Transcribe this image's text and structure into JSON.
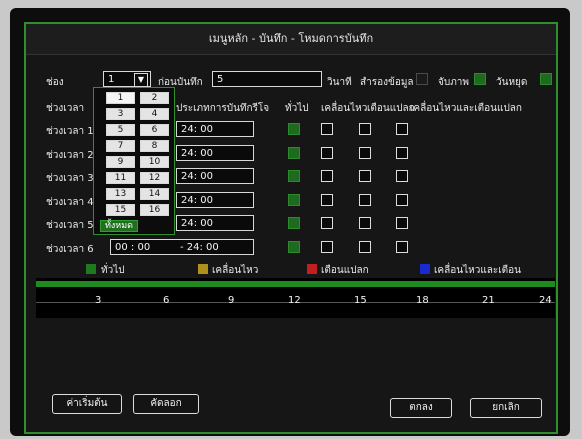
{
  "window": {
    "title": "เมนูหลัก - บันทึก - โหมดการบันทึก"
  },
  "channel": {
    "label": "ช่อง",
    "value": "1"
  },
  "prerecord": {
    "label": "ก่อนบันทึก",
    "value": "5",
    "unit": "วินาที"
  },
  "options": {
    "redundancy": "สำรองข้อมูล",
    "snapshot": "จับภาพ",
    "holiday": "วันหยุด"
  },
  "schedule": {
    "period_header": "ช่วงเวลา",
    "type_header": "ประเภทการบันทึกรีโจ",
    "col_general": "ทั่วไป",
    "col_motion": "เคลื่อนไหว",
    "col_alarm": "เตือนแปลก",
    "col_motion_alarm": "เคลื่อนไหวและเตือนแปลก",
    "rows": [
      {
        "label": "ช่วงเวลา 1",
        "start": "",
        "end": "24: 00"
      },
      {
        "label": "ช่วงเวลา 2",
        "start": "",
        "end": "24: 00"
      },
      {
        "label": "ช่วงเวลา 3",
        "start": "",
        "end": "24: 00"
      },
      {
        "label": "ช่วงเวลา 4",
        "start": "",
        "end": "24: 00"
      },
      {
        "label": "ช่วงเวลา 5",
        "start": "",
        "end": "24: 00"
      },
      {
        "label": "ช่วงเวลา 6",
        "start": "00 : 00",
        "end": "- 24: 00"
      }
    ]
  },
  "dropdown": {
    "options": [
      "1",
      "2",
      "3",
      "4",
      "5",
      "6",
      "7",
      "8",
      "9",
      "10",
      "11",
      "12",
      "13",
      "14",
      "15",
      "16"
    ],
    "all": "ทั้งหมด"
  },
  "legend": {
    "general": "ทั่วไป",
    "motion": "เคลื่อนไหว",
    "alarm": "เตือนแปลก",
    "motion_alarm": "เคลื่อนไหวและเตือน"
  },
  "timeline": {
    "ticks": [
      "3",
      "6",
      "9",
      "12",
      "15",
      "18",
      "21",
      "24"
    ]
  },
  "buttons": {
    "default": "ค่าเริ่มต้น",
    "copy": "คัดลอก",
    "ok": "ตกลง",
    "cancel": "ยกเลิก"
  },
  "colors": {
    "general": "#1e7a1e",
    "motion": "#b0901a",
    "alarm": "#c02020",
    "motion_alarm": "#1a2ad0",
    "accent": "#2f8f2f"
  }
}
